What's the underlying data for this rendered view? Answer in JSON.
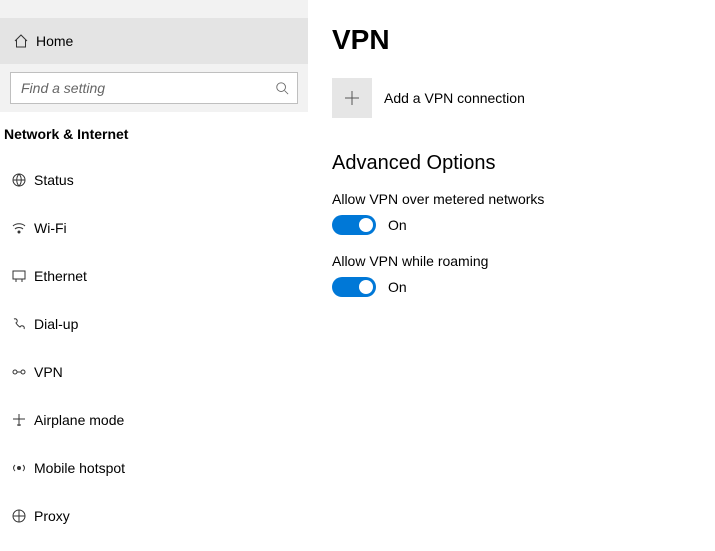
{
  "sidebar": {
    "home_label": "Home",
    "search_placeholder": "Find a setting",
    "category": "Network & Internet",
    "items": [
      {
        "label": "Status",
        "icon": "status-icon"
      },
      {
        "label": "Wi-Fi",
        "icon": "wifi-icon"
      },
      {
        "label": "Ethernet",
        "icon": "ethernet-icon"
      },
      {
        "label": "Dial-up",
        "icon": "dialup-icon"
      },
      {
        "label": "VPN",
        "icon": "vpn-icon"
      },
      {
        "label": "Airplane mode",
        "icon": "airplane-icon"
      },
      {
        "label": "Mobile hotspot",
        "icon": "hotspot-icon"
      },
      {
        "label": "Proxy",
        "icon": "proxy-icon"
      }
    ]
  },
  "main": {
    "title": "VPN",
    "add_label": "Add a VPN connection",
    "advanced_heading": "Advanced Options",
    "options": [
      {
        "label": "Allow VPN over metered networks",
        "state": "On",
        "on": true
      },
      {
        "label": "Allow VPN while roaming",
        "state": "On",
        "on": true
      }
    ]
  },
  "colors": {
    "accent": "#0078d7"
  }
}
